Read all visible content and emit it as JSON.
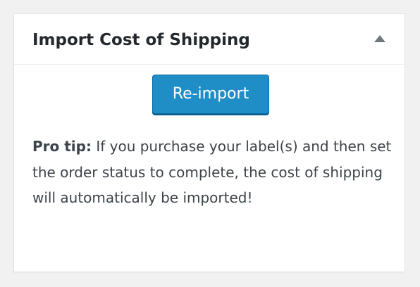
{
  "box": {
    "title": "Import Cost of Shipping",
    "toggle_icon": "triangle-up-icon"
  },
  "button": {
    "label": "Re-import"
  },
  "tip": {
    "label": "Pro tip:",
    "text": " If you purchase your label(s) and then set the order status to complete, the cost of shipping will automatically be imported!"
  },
  "colors": {
    "button_bg": "#1f8dc6",
    "button_border": "#0c6a9f",
    "text": "#23282d",
    "page_bg": "#f1f1f1"
  }
}
